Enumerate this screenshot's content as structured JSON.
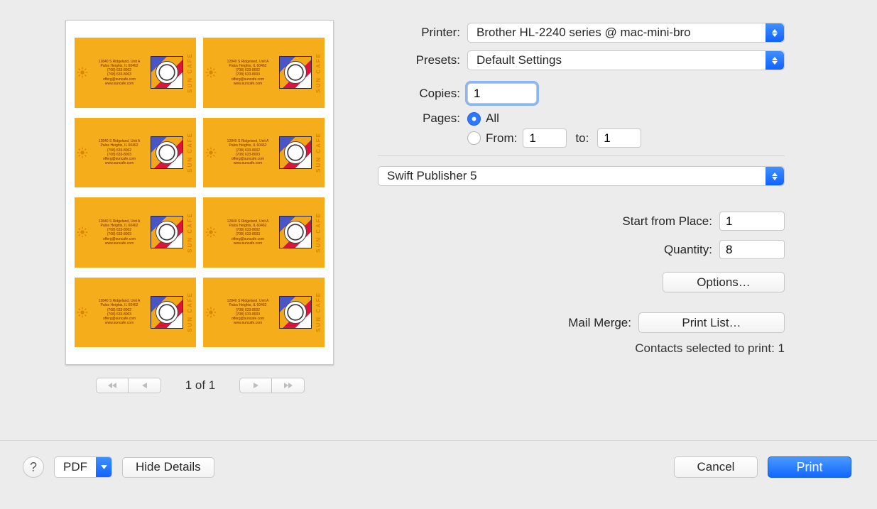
{
  "labels": {
    "printer": "Printer:",
    "presets": "Presets:",
    "copies": "Copies:",
    "pages": "Pages:",
    "all": "All",
    "from": "From:",
    "to": "to:",
    "start_from_place": "Start from Place:",
    "quantity": "Quantity:",
    "mail_merge": "Mail Merge:"
  },
  "printer_selected": "Brother HL-2240 series @ mac-mini-bro",
  "preset_selected": "Default Settings",
  "copies_value": "1",
  "pages_from": "1",
  "pages_to": "1",
  "app_panel": "Swift Publisher 5",
  "start_from_place": "1",
  "quantity": "8",
  "options_button": "Options…",
  "print_list_button": "Print List…",
  "contacts_note": "Contacts selected to print: 1",
  "pdf_button": "PDF",
  "hide_details_button": "Hide Details",
  "cancel_button": "Cancel",
  "print_button": "Print",
  "page_indicator": "1 of 1",
  "help_glyph": "?",
  "card_sample": {
    "tag": "SUN CAFE",
    "line1": "12840 S Ridgeland, Unit A",
    "line2": "Palos Heights, IL 60462",
    "line3": "(708) 633-8002",
    "line4": "(708) 633-8003",
    "line5": "offerg@suncafe.com",
    "line6": "www.suncafe.com"
  }
}
